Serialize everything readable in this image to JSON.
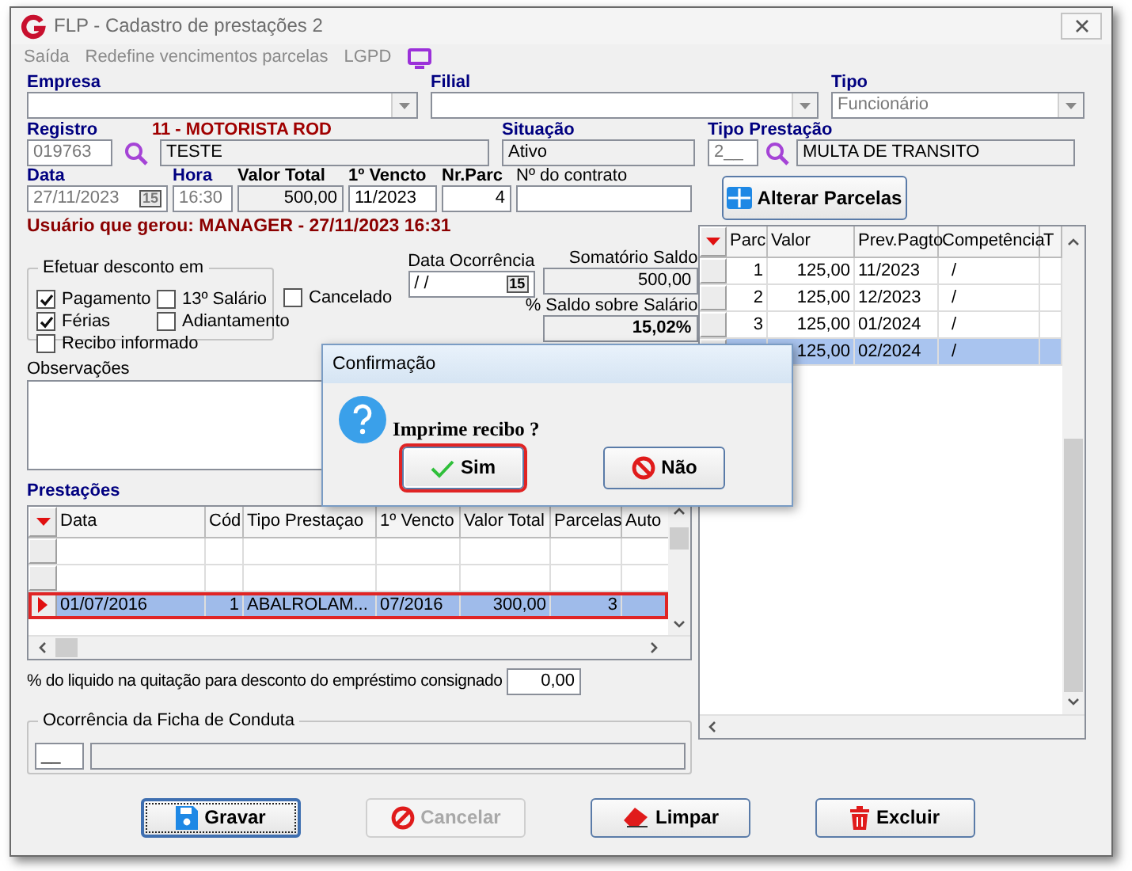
{
  "window": {
    "title": "FLP - Cadastro de prestações 2"
  },
  "menu": [
    {
      "label": "Saída"
    },
    {
      "label": "Redefine vencimentos parcelas"
    },
    {
      "label": "LGPD"
    }
  ],
  "empresa": {
    "label": "Empresa"
  },
  "filial": {
    "label": "Filial"
  },
  "tipo": {
    "label": "Tipo",
    "value": "Funcionário"
  },
  "registro": {
    "label": "Registro",
    "value": "019763",
    "caption": "11 - MOTORISTA ROD",
    "name": "TESTE"
  },
  "situacao": {
    "label": "Situação",
    "value": "Ativo"
  },
  "tipo_prestacao": {
    "label": "Tipo Prestação",
    "code": "2__",
    "description": "MULTA DE TRANSITO"
  },
  "data": {
    "label": "Data",
    "value": "27/11/2023",
    "calendar": "15"
  },
  "hora": {
    "label": "Hora",
    "value": "16:30"
  },
  "valor_total": {
    "label": "Valor Total",
    "value": "500,00"
  },
  "primeiro_vencto": {
    "label": "1º Vencto",
    "value": "11/2023"
  },
  "nr_parc": {
    "label": "Nr.Parc",
    "value": "4"
  },
  "contrato": {
    "label": "Nº do contrato"
  },
  "alterar_button": "Alterar Parcelas",
  "usuario": "Usuário que gerou: MANAGER - 27/11/2023 16:31",
  "desconto": {
    "title": "Efetuar desconto em",
    "options": [
      {
        "label": "Pagamento",
        "checked": true
      },
      {
        "label": "13º Salário",
        "checked": false
      },
      {
        "label": "Férias",
        "checked": true
      },
      {
        "label": "Adiantamento",
        "checked": false
      },
      {
        "label": "Recibo informado",
        "checked": false
      }
    ]
  },
  "cancelado": {
    "label": "Cancelado",
    "checked": false
  },
  "data_ocorrencia": {
    "label": "Data Ocorrência",
    "value": " / /",
    "calendar": "15"
  },
  "somatorio": {
    "label": "Somatório Saldo",
    "value": "500,00"
  },
  "saldo_salario": {
    "label": "% Saldo sobre Salário",
    "value": "15,02%"
  },
  "observacoes": {
    "label": "Observações"
  },
  "prestacoes": {
    "label": "Prestações",
    "columns": [
      "Data",
      "Cód",
      "Tipo Prestaçao",
      "1º Vencto",
      "Valor Total",
      "Parcelas",
      "Auto"
    ],
    "rows": [
      {
        "selected": false
      },
      {
        "selected": false
      },
      {
        "selected": true,
        "cells": [
          "01/07/2016",
          "1",
          "ABALROLAM...",
          "07/2016",
          "300,00",
          "3"
        ]
      }
    ]
  },
  "liquido": {
    "label": "% do liquido na quitação para desconto do empréstimo consignado",
    "value": "0,00"
  },
  "conduta": {
    "title": "Ocorrência da Ficha de Conduta",
    "code": "__"
  },
  "parcelas": {
    "columns": [
      "Parc",
      "Valor",
      "Prev.Pagto",
      "Competência",
      "T"
    ],
    "rows": [
      {
        "parc": "1",
        "valor": "125,00",
        "prev": "11/2023",
        "competencia": "/",
        "selected": false
      },
      {
        "parc": "2",
        "valor": "125,00",
        "prev": "12/2023",
        "competencia": "/",
        "selected": false
      },
      {
        "parc": "3",
        "valor": "125,00",
        "prev": "01/2024",
        "competencia": "/",
        "selected": false
      },
      {
        "valor": "125,00",
        "prev": "02/2024",
        "competencia": "/",
        "selected": true
      }
    ]
  },
  "buttons": [
    {
      "label": "Gravar",
      "kind": "save",
      "focused": true,
      "disabled": false
    },
    {
      "label": "Cancelar",
      "kind": "cancel",
      "focused": false,
      "disabled": true
    },
    {
      "label": "Limpar",
      "kind": "clear",
      "focused": false,
      "disabled": false
    },
    {
      "label": "Excluir",
      "kind": "delete",
      "focused": false,
      "disabled": false
    }
  ],
  "dialog": {
    "title": "Confirmação",
    "message": "Imprime recibo ?",
    "buttons": [
      {
        "label": "Sim",
        "kind": "yes",
        "selected": true
      },
      {
        "label": "Não",
        "kind": "no",
        "selected": false
      }
    ]
  }
}
